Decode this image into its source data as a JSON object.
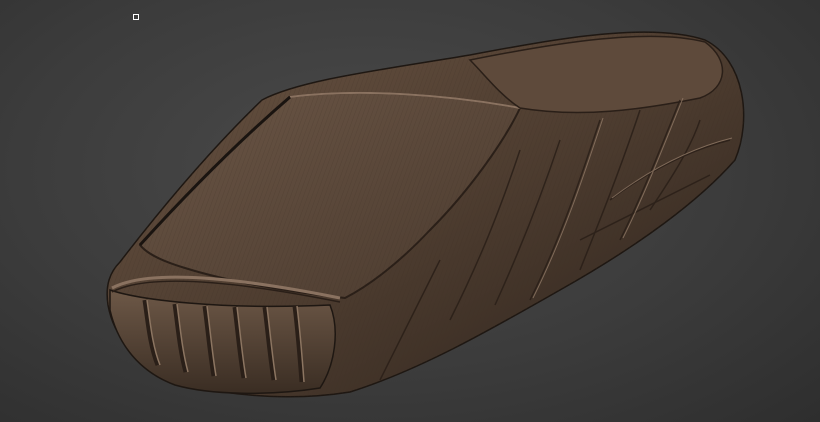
{
  "viewport": {
    "background_color": "#3f3f3f",
    "content": "3d-sculpt-model",
    "model_color": "#5a4637"
  },
  "cursor": {
    "icon": "square-cursor-icon"
  }
}
